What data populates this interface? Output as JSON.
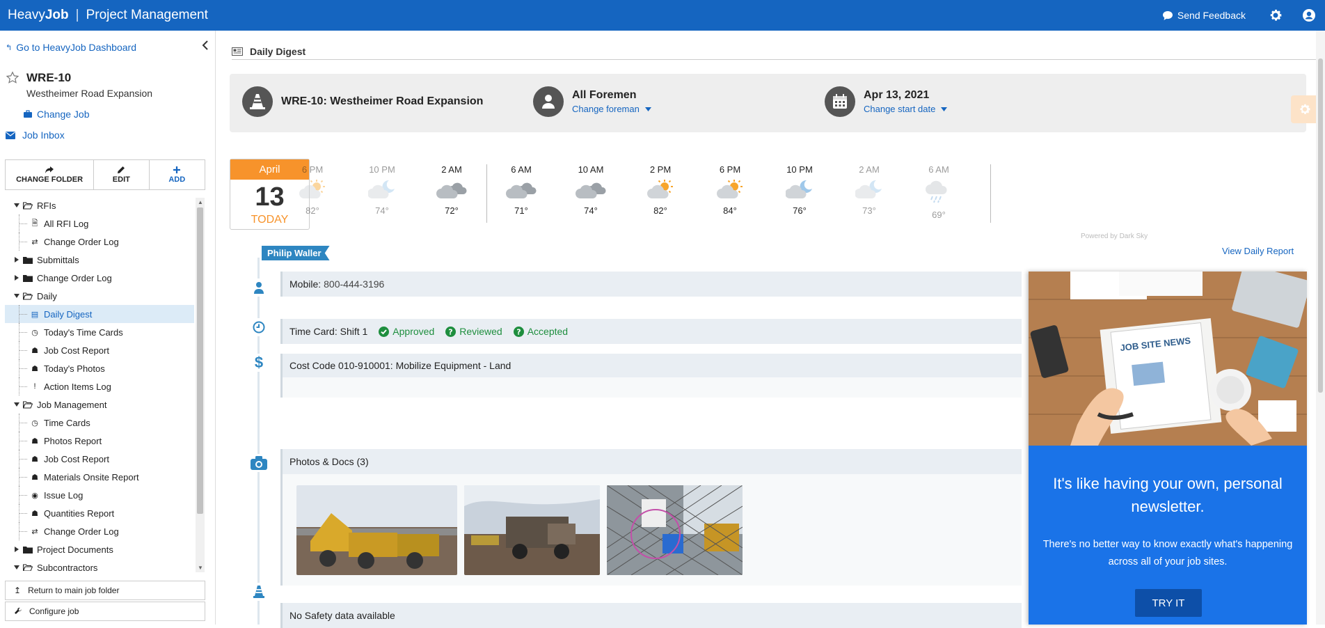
{
  "topbar": {
    "brand_light": "Heavy",
    "brand_bold": "Job",
    "separator": "|",
    "module": "Project Management",
    "feedback": "Send Feedback",
    "icons": [
      "chat-icon",
      "gear-icon",
      "user-icon"
    ],
    "color": "#1565c0"
  },
  "sidebar": {
    "goto": "Go to HeavyJob Dashboard",
    "job_code": "WRE-10",
    "job_name": "Westheimer Road Expansion",
    "change_job": "Change Job",
    "inbox": "Job Inbox",
    "tools": [
      {
        "label": "CHANGE FOLDER",
        "icon": "share-icon"
      },
      {
        "label": "EDIT",
        "icon": "pencil-icon"
      },
      {
        "label": "ADD",
        "icon": "plus-icon"
      }
    ],
    "tree": [
      {
        "label": "RFIs",
        "level": 0,
        "type": "folder-open"
      },
      {
        "label": "All RFI Log",
        "level": 1,
        "type": "doc"
      },
      {
        "label": "Change Order Log",
        "level": 1,
        "type": "swap"
      },
      {
        "label": "Submittals",
        "level": 0,
        "type": "folder"
      },
      {
        "label": "Change Order Log",
        "level": 0,
        "type": "folder"
      },
      {
        "label": "Daily",
        "level": 0,
        "type": "folder-open"
      },
      {
        "label": "Daily Digest",
        "level": 1,
        "type": "digest",
        "selected": true
      },
      {
        "label": "Today's Time Cards",
        "level": 1,
        "type": "clock"
      },
      {
        "label": "Job Cost Report",
        "level": 1,
        "type": "report"
      },
      {
        "label": "Today's Photos",
        "level": 1,
        "type": "report"
      },
      {
        "label": "Action Items Log",
        "level": 1,
        "type": "alert"
      },
      {
        "label": "Job Management",
        "level": 0,
        "type": "folder-open"
      },
      {
        "label": "Time Cards",
        "level": 1,
        "type": "clock"
      },
      {
        "label": "Photos Report",
        "level": 1,
        "type": "report"
      },
      {
        "label": "Job Cost Report",
        "level": 1,
        "type": "report"
      },
      {
        "label": "Materials Onsite Report",
        "level": 1,
        "type": "report"
      },
      {
        "label": "Issue Log",
        "level": 1,
        "type": "issue"
      },
      {
        "label": "Quantities Report",
        "level": 1,
        "type": "report"
      },
      {
        "label": "Change Order Log",
        "level": 1,
        "type": "swap"
      },
      {
        "label": "Project Documents",
        "level": 0,
        "type": "folder"
      },
      {
        "label": "Subcontractors",
        "level": 0,
        "type": "folder-open"
      }
    ],
    "return": "Return to main job folder",
    "configure": "Configure job"
  },
  "main": {
    "title": "Daily Digest",
    "job_header": "WRE-10: Westheimer Road Expansion",
    "foreman_title": "All Foremen",
    "foreman_link": "Change foreman",
    "date_title": "Apr 13, 2021",
    "date_link": "Change start date",
    "date_box": {
      "month": "April",
      "day": "13",
      "today": "TODAY"
    },
    "weather": [
      {
        "time": "6 PM",
        "temp": "82°",
        "icon": "sun-cloud",
        "dim": true
      },
      {
        "time": "10 PM",
        "temp": "74°",
        "icon": "moon-cloud",
        "dim": true
      },
      {
        "time": "2 AM",
        "temp": "72°",
        "icon": "clouds",
        "dim": false
      },
      {
        "time": "6 AM",
        "temp": "71°",
        "icon": "clouds",
        "dim": false
      },
      {
        "time": "10 AM",
        "temp": "74°",
        "icon": "clouds",
        "dim": false
      },
      {
        "time": "2 PM",
        "temp": "82°",
        "icon": "sun-cloud",
        "dim": false
      },
      {
        "time": "6 PM",
        "temp": "84°",
        "icon": "sun-cloud",
        "dim": false
      },
      {
        "time": "10 PM",
        "temp": "76°",
        "icon": "moon-cloud",
        "dim": false
      },
      {
        "time": "2 AM",
        "temp": "73°",
        "icon": "moon-cloud",
        "dim": true
      },
      {
        "time": "6 AM",
        "temp": "69°",
        "icon": "rain",
        "dim": true
      }
    ],
    "powered": "Powered by Dark Sky",
    "foreman_name": "Philip Waller",
    "view_report": "View Daily Report",
    "mobile_label": "Mobile:",
    "mobile_value": "800-444-3196",
    "timecard_label": "Time Card: Shift 1",
    "status_approved": "Approved",
    "status_reviewed": "Reviewed",
    "status_accepted": "Accepted",
    "cost_code_prefix": "Cost Code 010-910001:",
    "cost_code_name": "Mobilize Equipment - Land",
    "photos_label": "Photos & Docs (3)",
    "safety": "No Safety data available"
  },
  "popup": {
    "art_title": "JOB SITE NEWS",
    "headline": "It's like having your own, personal newsletter.",
    "body": "There's no better way to know exactly what's happening across all of your job sites.",
    "button": "TRY IT"
  }
}
